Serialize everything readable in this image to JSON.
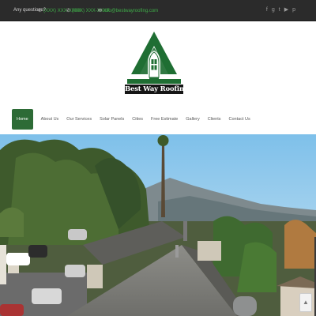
{
  "topbar": {
    "question": "Any questions?",
    "phone1": "(XXX) XXX-XXXX",
    "phone2": "(XXX) XXX-XXXX",
    "email": "info@bestwayroofing.com",
    "social_icons": [
      "facebook-icon",
      "google-plus-icon",
      "twitter-icon",
      "youtube-icon",
      "pinterest-icon"
    ]
  },
  "brand": {
    "name": "Best Way Roofing",
    "color": "#1f6e33"
  },
  "nav": {
    "items": [
      "Home",
      "About Us",
      "Our Services",
      "Solar Panels",
      "Cities",
      "Free Estimate",
      "Gallery",
      "Clients",
      "Contact Us"
    ],
    "active": "Home",
    "active_color": "#2d6b36"
  },
  "hero": {
    "description_icon": "hero-photo"
  }
}
